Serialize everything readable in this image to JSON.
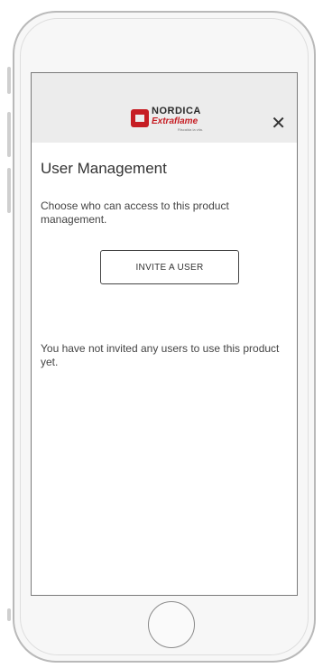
{
  "header": {
    "brand_top": "NORDICA",
    "brand_sub": "Extraflame",
    "brand_tagline": "Riscalda la vita.",
    "close_glyph": "✕",
    "close_icon": "close-icon"
  },
  "main": {
    "title": "User Management",
    "description": "Choose who can access to this product management.",
    "invite_button_label": "INVITE A USER",
    "empty_message": "You have not invited any users to use this product yet."
  },
  "colors": {
    "brand_red": "#c61d23",
    "header_bg": "#ececec",
    "text": "#333333"
  }
}
